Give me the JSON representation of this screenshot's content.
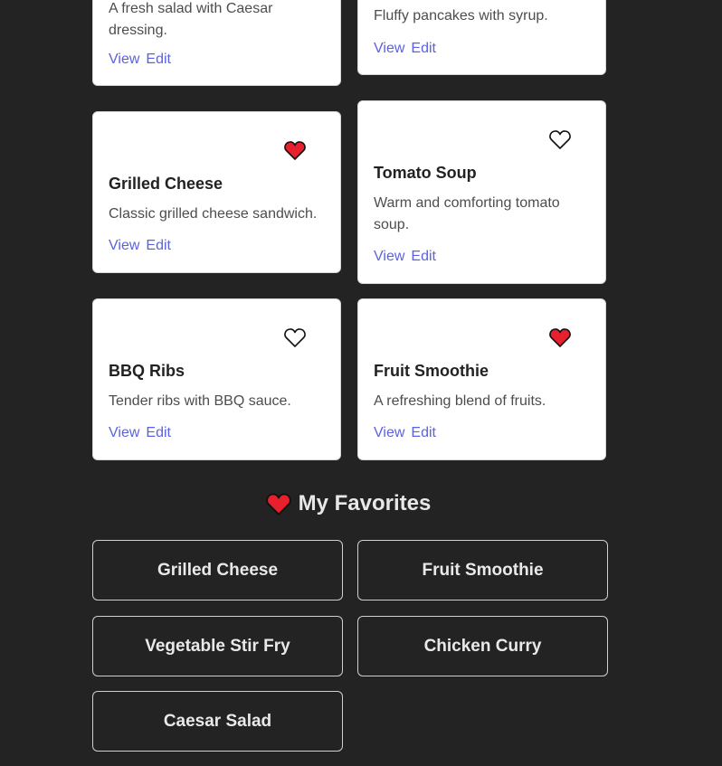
{
  "links": {
    "view": "View",
    "edit": "Edit"
  },
  "cards": [
    {
      "title": "",
      "description": "A fresh salad with Caesar dressing.",
      "favorite": null
    },
    {
      "title": "",
      "description": "Fluffy pancakes with syrup.",
      "favorite": null
    },
    {
      "title": "Grilled Cheese",
      "description": "Classic grilled cheese sandwich.",
      "favorite": true
    },
    {
      "title": "Tomato Soup",
      "description": "Warm and comforting tomato soup.",
      "favorite": false
    },
    {
      "title": "BBQ Ribs",
      "description": "Tender ribs with BBQ sauce.",
      "favorite": false
    },
    {
      "title": "Fruit Smoothie",
      "description": "A refreshing blend of fruits.",
      "favorite": true
    }
  ],
  "favorites_section": {
    "heading": "My Favorites",
    "icon": "heart-icon",
    "items": [
      "Grilled Cheese",
      "Fruit Smoothie",
      "Vegetable Stir Fry",
      "Chicken Curry",
      "Caesar Salad"
    ]
  },
  "colors": {
    "background": "#232323",
    "link": "#5b62e0",
    "heart_filled": "#e8202d"
  }
}
